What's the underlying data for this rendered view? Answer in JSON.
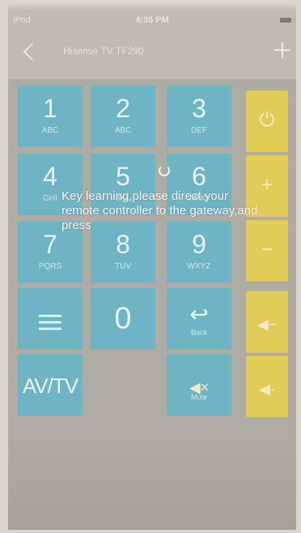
{
  "status_bar": {
    "carrier": "iPod",
    "time": "4:35 PM"
  },
  "nav": {
    "title": "Hisense TV TF290"
  },
  "keys": [
    {
      "id": "key-1",
      "num": "1",
      "letters": "ABC"
    },
    {
      "id": "key-2",
      "num": "2",
      "letters": "ABC"
    },
    {
      "id": "key-3",
      "num": "3",
      "letters": "DEF"
    },
    {
      "id": "key-4",
      "num": "4",
      "letters": "GHI"
    },
    {
      "id": "key-5",
      "num": "5",
      "letters": "JKL"
    },
    {
      "id": "key-6",
      "num": "6",
      "letters": "MNO"
    },
    {
      "id": "key-7",
      "num": "7",
      "letters": "PQRS"
    },
    {
      "id": "key-8",
      "num": "8",
      "letters": "TUV"
    },
    {
      "id": "key-9",
      "num": "9",
      "letters": "WXYZ"
    }
  ],
  "zero_key": "0",
  "avtv_key": "AV/TV",
  "back_key_label": "Back",
  "mute_key_label": "Mute",
  "icons": {
    "power": "power-icon",
    "volume_up": "plus-icon",
    "volume_down": "minus-icon",
    "channel_up": "speaker-icon",
    "channel_down": "speaker-icon",
    "menu": "menu-icon",
    "back": "return-icon",
    "mute": "mute-icon"
  },
  "colors": {
    "blue_key": "#6fb4c5",
    "yellow_key": "#e2cc58"
  },
  "overlay_message": "Key learning,please direct your remote controller to the gateway,and press"
}
